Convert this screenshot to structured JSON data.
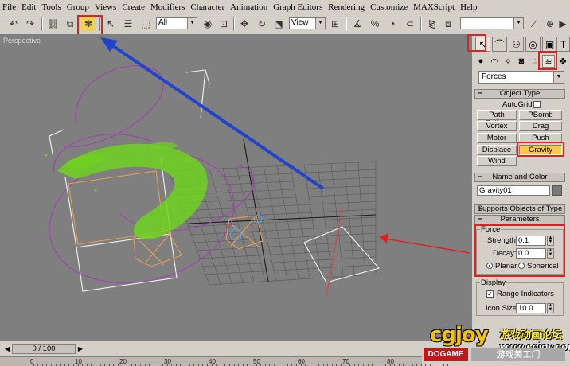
{
  "menu": [
    "File",
    "Edit",
    "Tools",
    "Group",
    "Views",
    "Create",
    "Modifiers",
    "Character",
    "Animation",
    "Graph Editors",
    "Rendering",
    "Customize",
    "MAXScript",
    "Help"
  ],
  "toolbar": {
    "filter_value": "All",
    "coord_value": "View",
    "named_sel_value": ""
  },
  "viewport": {
    "label": "Perspective"
  },
  "panel": {
    "category_value": "Forces",
    "object_type": {
      "title": "Object Type",
      "autogrid": "AutoGrid",
      "buttons": [
        "Path Follow",
        "PBomb",
        "Vortex",
        "Drag",
        "Motor",
        "Push",
        "Displace",
        "Gravity",
        "Wind"
      ],
      "active": "Gravity"
    },
    "name_color": {
      "title": "Name and Color",
      "name_value": "Gravity01"
    },
    "supports": {
      "title": "Supports Objects of Type"
    },
    "parameters": {
      "title": "Parameters",
      "force_group": "Force",
      "strength_label": "Strength:",
      "strength_value": "0.1",
      "decay_label": "Decay:",
      "decay_value": "0.0",
      "planar_label": "Planar",
      "spherical_label": "Spherical",
      "mode": "Planar",
      "display_group": "Display",
      "range_label": "Range Indicators",
      "range_checked": true,
      "icon_size_label": "Icon Size:",
      "icon_size_value": "10.0"
    }
  },
  "timeline": {
    "frame": "0 / 100",
    "ruler": [
      "0",
      "10",
      "20",
      "30",
      "40",
      "50",
      "60",
      "70",
      "80"
    ]
  },
  "watermark": {
    "logo": "cgjoy",
    "cn_title": "游戏动画论坛",
    "url": "www.cgjoy.com",
    "badge": "DOGAME",
    "cn_sub": "游戏美工门"
  },
  "colors": {
    "highlight": "#f5c94a",
    "annotation_red": "#e02020",
    "annotation_blue": "#2244cc",
    "particles": "#6fd21e"
  }
}
